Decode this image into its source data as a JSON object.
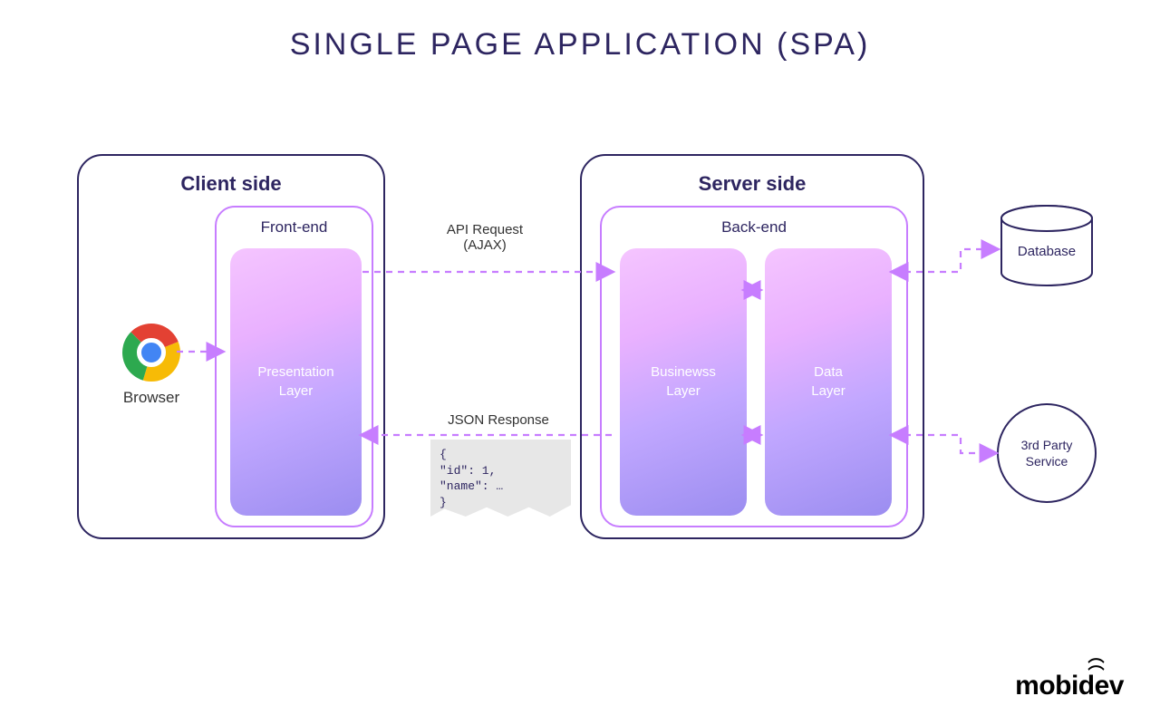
{
  "title": "SINGLE PAGE APPLICATION (SPA)",
  "client": {
    "panel_title": "Client side",
    "inner_title": "Front-end",
    "layer": {
      "line1": "Presentation",
      "line2": "Layer"
    },
    "browser_label": "Browser"
  },
  "server": {
    "panel_title": "Server side",
    "inner_title": "Back-end",
    "biz": {
      "line1": "Businewss",
      "line2": "Layer"
    },
    "data": {
      "line1": "Data",
      "line2": "Layer"
    }
  },
  "arrows": {
    "request_l1": "API Request",
    "request_l2": "(AJAX)",
    "response": "JSON Response"
  },
  "json_snippet": {
    "l1": "{",
    "l2": "    \"id\": 1,",
    "l3": "    \"name\": …",
    "l4": "}"
  },
  "external": {
    "database": "Database",
    "tps_l1": "3rd Party",
    "tps_l2": "Service"
  },
  "brand": "mobidev"
}
